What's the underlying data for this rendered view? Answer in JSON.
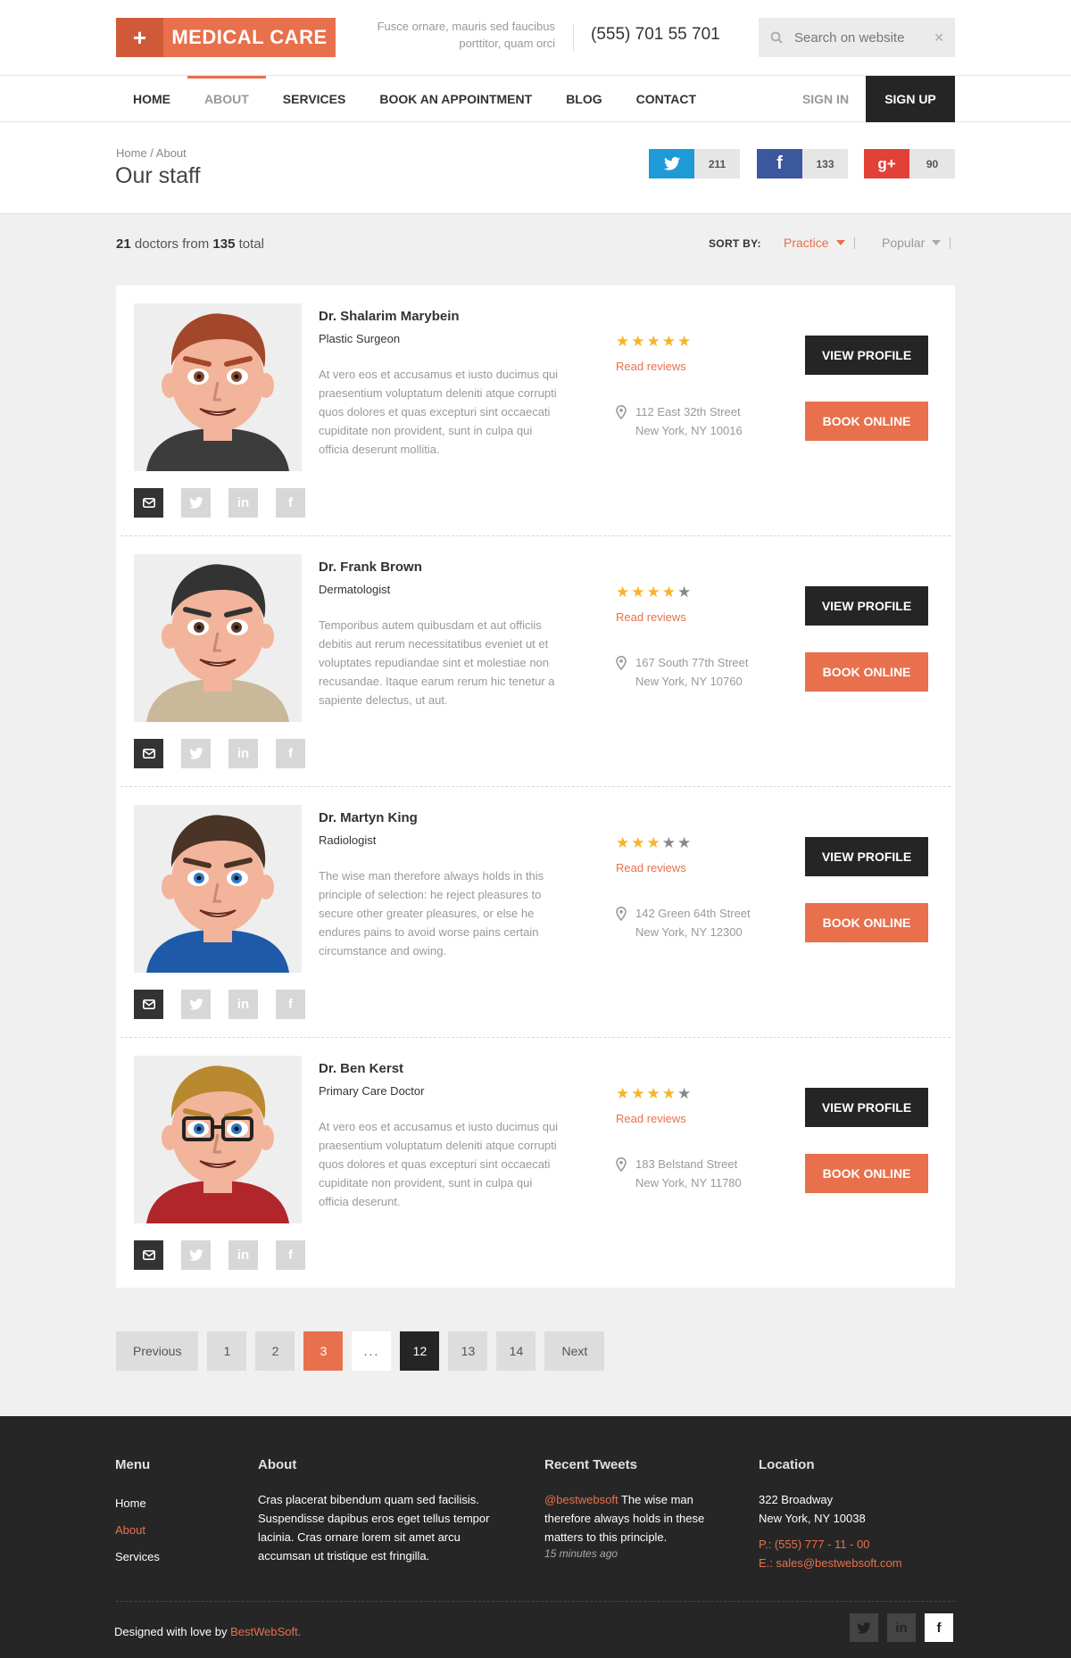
{
  "header": {
    "logo_plus": "+",
    "logo_text": "MEDICAL CARE",
    "tagline_line1": "Fusce ornare, mauris sed faucibus",
    "tagline_line2": "porttitor, quam orci",
    "phone": "(555) 701 55 701",
    "search_placeholder": "Search on website",
    "search_clear": "✕"
  },
  "nav": {
    "items": [
      "HOME",
      "ABOUT",
      "SERVICES",
      "BOOK AN APPOINTMENT",
      "BLOG",
      "CONTACT"
    ],
    "active": "ABOUT",
    "sign_in": "SIGN IN",
    "sign_up": "SIGN UP"
  },
  "titlebar": {
    "breadcrumb": "Home / About",
    "title": "Our staff",
    "share": [
      {
        "network": "twitter",
        "icon": "twitter-icon",
        "color": "#1e9bd7",
        "count": "211"
      },
      {
        "network": "facebook",
        "icon": "facebook-icon",
        "color": "#3b579d",
        "count": "133"
      },
      {
        "network": "google-plus",
        "icon": "google-plus-icon",
        "color": "#e14137",
        "count": "90"
      }
    ]
  },
  "results": {
    "shown": "21",
    "text_mid": " doctors from ",
    "total": "135",
    "text_end": " total",
    "sort_label": "SORT BY:",
    "sort_options": [
      "Practice",
      "Popular"
    ]
  },
  "doctors": [
    {
      "name": "Dr. Shalarim Marybein",
      "specialty": "Plastic Surgeon",
      "description": "At vero eos et accusamus et iusto ducimus qui praesentium voluptatum deleniti atque corrupti quos dolores et quas excepturi sint occaecati cupiditate non provident, sunt in culpa qui officia deserunt mollitia.",
      "rating": 5,
      "reviews_label": "Read reviews",
      "address_line1": "112 East 32th Street",
      "address_line2": "New York, NY 10016",
      "view_label": "VIEW PROFILE",
      "book_label": "BOOK ONLINE"
    },
    {
      "name": "Dr. Frank Brown",
      "specialty": "Dermatologist",
      "description": "Temporibus autem quibusdam et aut officiis debitis aut rerum necessitatibus eveniet ut et voluptates repudiandae sint et molestiae non recusandae. Itaque earum rerum hic tenetur a sapiente delectus, ut aut.",
      "rating": 4,
      "reviews_label": "Read reviews",
      "address_line1": "167 South 77th Street",
      "address_line2": "New York, NY 10760",
      "view_label": "VIEW PROFILE",
      "book_label": "BOOK ONLINE"
    },
    {
      "name": "Dr. Martyn King",
      "specialty": "Radiologist",
      "description": "The wise man therefore always holds in this principle of selection: he reject pleasures to secure other greater pleasures, or else he endures pains to avoid worse pains certain circumstance and owing.",
      "rating": 3,
      "reviews_label": "Read reviews",
      "address_line1": "142 Green 64th Street",
      "address_line2": "New York, NY 12300",
      "view_label": "VIEW PROFILE",
      "book_label": "BOOK ONLINE"
    },
    {
      "name": "Dr. Ben Kerst",
      "specialty": "Primary Care Doctor",
      "description": "At vero eos et accusamus et iusto ducimus qui praesentium voluptatum deleniti atque corrupti quos dolores et quas excepturi sint occaecati cupiditate non provident, sunt in culpa qui officia deserunt.",
      "rating": 4,
      "reviews_label": "Read reviews",
      "address_line1": "183 Belstand Street",
      "address_line2": "New York, NY 11780",
      "view_label": "VIEW PROFILE",
      "book_label": "BOOK ONLINE"
    }
  ],
  "pagination": {
    "previous": "Previous",
    "pages": [
      "1",
      "2",
      "3",
      "...",
      "12",
      "13",
      "14"
    ],
    "current": "3",
    "next": "Next"
  },
  "footer": {
    "menu": {
      "heading": "Menu",
      "items": [
        "Home",
        "About",
        "Services"
      ],
      "active": "About"
    },
    "about": {
      "heading": "About",
      "text": "Cras placerat bibendum quam sed facilisis. Suspendisse dapibus eros eget tellus tempor lacinia. Cras ornare lorem sit amet arcu accumsan ut tristique est fringilla."
    },
    "tweets": {
      "heading": "Recent Tweets",
      "handle": "@bestwebsoft",
      "text": " The wise man therefore always holds in these matters to this principle.",
      "time": "15 minutes ago"
    },
    "location": {
      "heading": "Location",
      "line1": "322 Broadway",
      "line2": "New York, NY 10038",
      "phone": "P.: (555) 777 - 11 - 00",
      "email": "E.: sales@bestwebsoft.com"
    },
    "credits_prefix": "Designed with love by ",
    "credits_brand": "BestWebSoft.",
    "socials": [
      "twitter-icon",
      "linkedin-icon",
      "facebook-icon"
    ]
  },
  "colors": {
    "accent": "#e8704c",
    "dark": "#252525",
    "star": "#f7b32b"
  }
}
